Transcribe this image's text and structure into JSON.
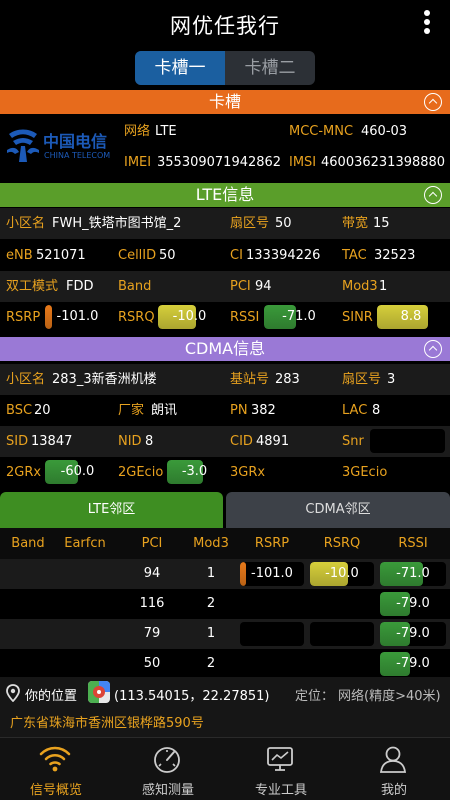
{
  "app": {
    "title": "网优任我行"
  },
  "sim_tabs": {
    "tab1": "卡槽一",
    "tab2": "卡槽二"
  },
  "sim": {
    "header": "卡槽",
    "operator_logo": {
      "cn": "中国电信",
      "en": "CHINA TELECOM"
    },
    "network_label": "网络",
    "network_value": "LTE",
    "mcc_label": "MCC-MNC",
    "mcc_value": "460-03",
    "imei_label": "IMEI",
    "imei_value": "355309071942862",
    "imsi_label": "IMSI",
    "imsi_value": "460036231398880"
  },
  "lte": {
    "header": "LTE信息",
    "cell_name_label": "小区名",
    "cell_name_value": "FWH_铁塔市图书馆_2",
    "sector_label": "扇区号",
    "sector_value": "50",
    "bandwidth_label": "带宽",
    "bandwidth_value": "15",
    "enb_label": "eNB",
    "enb_value": "521071",
    "cellid_label": "CellID",
    "cellid_value": "50",
    "ci_label": "CI",
    "ci_value": "133394226",
    "tac_label": "TAC",
    "tac_value": "32523",
    "duplex_label": "双工模式",
    "duplex_value": "FDD",
    "band_label": "Band",
    "band_value": "",
    "pci_label": "PCI",
    "pci_value": "94",
    "mod3_label": "Mod3",
    "mod3_value": "1",
    "rsrp_label": "RSRP",
    "rsrp_value": "-101.0",
    "rsrp_level": 0.1,
    "rsrq_label": "RSRQ",
    "rsrq_value": "-10.0",
    "rsrq_level": 0.6,
    "rssi_label": "RSSI",
    "rssi_value": "-71.0",
    "rssi_level": 0.45,
    "sinr_label": "SINR",
    "sinr_value": "8.8",
    "sinr_level": 0.75
  },
  "cdma": {
    "header": "CDMA信息",
    "cell_name_label": "小区名",
    "cell_name_value": "283_3新香洲机楼",
    "base_label": "基站号",
    "base_value": "283",
    "sector_label": "扇区号",
    "sector_value": "3",
    "bsc_label": "BSC",
    "bsc_value": "20",
    "vendor_label": "厂家",
    "vendor_value": "朗讯",
    "pn_label": "PN",
    "pn_value": "382",
    "lac_label": "LAC",
    "lac_value": "8",
    "sid_label": "SID",
    "sid_value": "13847",
    "nid_label": "NID",
    "nid_value": "8",
    "cid_label": "CID",
    "cid_value": "4891",
    "snr_label": "Snr",
    "snr_value": "",
    "rx2g_label": "2GRx",
    "rx2g_value": "-60.0",
    "rx2g_level": 0.5,
    "ecio2g_label": "2GEcio",
    "ecio2g_value": "-3.0",
    "ecio2g_level": 0.65,
    "rx3g_label": "3GRx",
    "rx3g_value": "",
    "ecio3g_label": "3GEcio",
    "ecio3g_value": ""
  },
  "neighbor_tabs": {
    "lte": "LTE邻区",
    "cdma": "CDMA邻区"
  },
  "neighbor_table": {
    "headers": [
      "Band",
      "Earfcn",
      "PCI",
      "Mod3",
      "RSRP",
      "RSRQ",
      "RSSI"
    ],
    "rows": [
      {
        "band": "",
        "earfcn": "",
        "pci": "94",
        "mod3": "1",
        "rsrp": "-101.0",
        "rsrp_level": 0.1,
        "rsrq": "-10.0",
        "rsrq_level": 0.6,
        "rssi": "-71.0",
        "rssi_level": 0.65
      },
      {
        "band": "",
        "earfcn": "",
        "pci": "116",
        "mod3": "2",
        "rsrp": "",
        "rsrp_level": 0,
        "rsrq": "",
        "rsrq_level": 0,
        "rssi": "-79.0",
        "rssi_level": 0.45
      },
      {
        "band": "",
        "earfcn": "",
        "pci": "79",
        "mod3": "1",
        "rsrp": "",
        "rsrp_level": 0,
        "rsrq": "",
        "rsrq_level": 0,
        "rssi": "-79.0",
        "rssi_level": 0.45
      },
      {
        "band": "",
        "earfcn": "",
        "pci": "50",
        "mod3": "2",
        "rsrp": "",
        "rsrp_level": 0,
        "rsrq": "",
        "rsrq_level": 0,
        "rssi": "-79.0",
        "rssi_level": 0.45
      }
    ]
  },
  "location": {
    "label": "你的位置",
    "coords": "(113.54015，22.27851)",
    "mode_label": "定位：",
    "mode_value": "网络(精度>40米)",
    "address": "广东省珠海市香洲区银桦路590号"
  },
  "bottom_nav": [
    {
      "label": "信号概览",
      "icon": "wifi-signal-icon",
      "active": true
    },
    {
      "label": "感知测量",
      "icon": "speedometer-icon",
      "active": false
    },
    {
      "label": "专业工具",
      "icon": "monitor-tool-icon",
      "active": false
    },
    {
      "label": "我的",
      "icon": "user-icon",
      "active": false
    }
  ],
  "colors": {
    "sim_header": "#e76b1c",
    "lte_header": "#5a9e2a",
    "cdma_header": "#9a79d6",
    "label": "#e8a21f",
    "meter_orange": "#e87a1a",
    "meter_yellow": "#d6cf3b",
    "meter_green": "#3a9a3a",
    "sim_tab_active": "#1b5fa0"
  }
}
